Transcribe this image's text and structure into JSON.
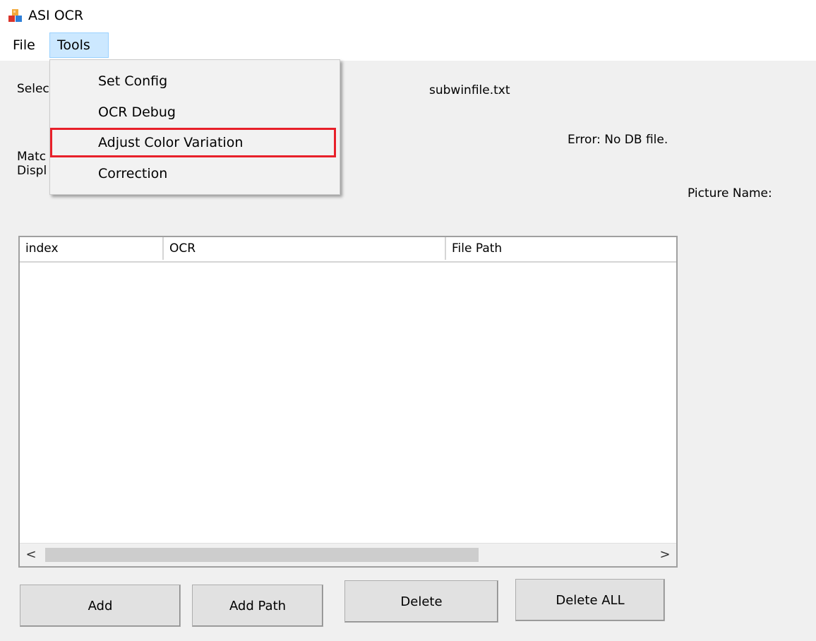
{
  "window": {
    "title": "ASI OCR",
    "icon": "app-cubes-icon"
  },
  "menubar": {
    "file": "File",
    "tools": "Tools"
  },
  "tools_menu": {
    "items": [
      {
        "label": "Set Config"
      },
      {
        "label": "OCR Debug"
      },
      {
        "label": "Adjust Color Variation",
        "highlighted": true
      },
      {
        "label": "Correction"
      }
    ],
    "highlight_color": "#e8202a"
  },
  "main": {
    "select_label_partial": "Selec",
    "subwin_file": "subwinfile.txt",
    "error_text": "Error: No DB file.",
    "match_label_partial": "Matc",
    "display_label_partial": "Displ",
    "picture_name_label": "Picture Name:"
  },
  "listview": {
    "columns": [
      "index",
      "OCR",
      "File Path"
    ],
    "rows": [],
    "scroll_left": "<",
    "scroll_right": ">"
  },
  "buttons": {
    "add": "Add",
    "add_path": "Add Path",
    "delete": "Delete",
    "delete_all": "Delete ALL"
  }
}
